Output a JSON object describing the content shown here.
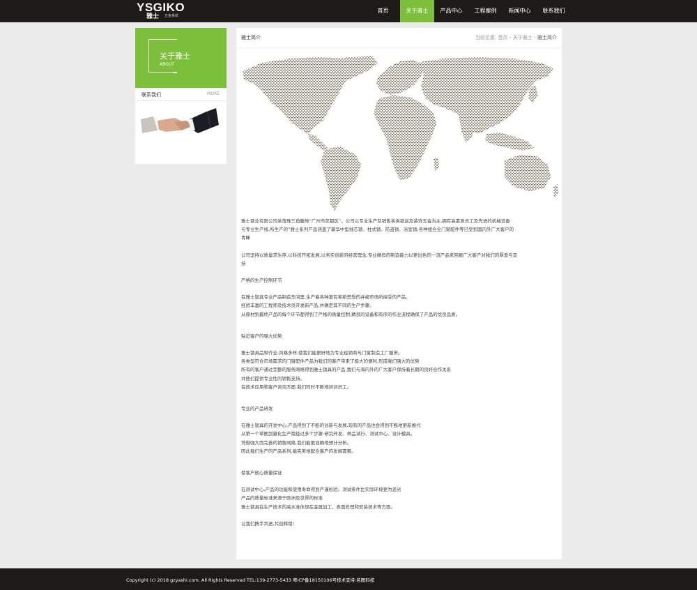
{
  "header": {
    "logo_text": "YSGIKO",
    "logo_cn": "雅士",
    "logo_sub": "五金系统",
    "nav": [
      "首页",
      "关于雅士",
      "产品中心",
      "工程案例",
      "新闻中心",
      "联系我们"
    ],
    "active_index": 1
  },
  "sidebar": {
    "about_title": "关于雅士",
    "about_sub": "ABOUT",
    "contact_title": "联系我们",
    "contact_more": "MORE"
  },
  "main": {
    "title": "雅士简介",
    "breadcrumb": {
      "prefix": "当前位置:",
      "items": [
        "首页",
        "关于雅士",
        "雅士简介"
      ]
    },
    "paragraphs": [
      "雅士锁业有限公司坐落珠三角腹地“广州市花都区”。公司以专业生产及销售各类锁具及装饰五金为主,拥有高素质员工及先进的机械设备",
      "与专业生产线,所生产的”雅士系列产品涵盖了豪华中型插芯锁、柱式锁、防盗锁、浴室锁;各种组合全门窗配件等已受到国内外广大客户的",
      "青睐",
      "公司坚持以质量求生存,以科技开拓发展,以务实创新的经营理念,专业精良的制造能力以更出色的一流产品来回报广大客户对我们的厚爱与支",
      "持",
      "严格的生产控制环节",
      "在雅士锁具专业产品制造车间里,生产着各种富有革新思想的并被市场所接受的产品。",
      "经验丰富的工程师及技术员开发新产品,并确定其不同的生产步骤。",
      "从原材到最终产品的每个环节都得到了严格的质量控制,精良的设备和有序的作业流程确保了产品的优良品质。",
      "贴近客户的强大优势",
      "雅士锁具品种齐全,风格多样,使我们能更好地为专业经销商与门窗制造工厂服务。",
      "各类型符合市场需求的门窗配件产品为我们的客户带来了极大的便利,形成我们强大的优势",
      "所有的客户通过完整的服务网络得到雅士锁具的产品,我们与海内外的广大客户保持着长期的良好合作关系",
      "并他们提供专业性的销售支持。",
      "在技术应用和客户咨询方面,我们同时不断地培训员工。",
      "专业的产品研发",
      "在雅士锁具的开发中心,产品得到了不断的创新与发展,现有的产品也会得到不断地更新换代",
      "从第一个草图到量化生产需经过多个步骤:研究开发、样品试行、测试中心、设计模具。",
      "凭借强大而完善的销售网络,我们能更准确地预计分析。",
      "因此我们生产的产品系列,能完美地配合客户的发展需要。",
      "使客户放心质量保证",
      "在测试中心,产品的功能和使用寿命得到严谨检验。测试条件比实际环境更为恶劣",
      "产品的质量标准来源于欧洲及世界的标准",
      "雅士锁具在生产技术的高水准体现在金属加工、表面处理和安装技术等方面。",
      "让我们携手共进,共创辉煌!"
    ]
  },
  "footer": {
    "text": "Copyright (c) 2018 gzyashi.com. All Rights Reserved TEL:139-2773-5433   粤ICP备18150106号技术支持:名图科技"
  },
  "colors": {
    "accent": "#7cbf3a",
    "header_bg": "#1e1a18",
    "page_bg": "#ececec"
  }
}
